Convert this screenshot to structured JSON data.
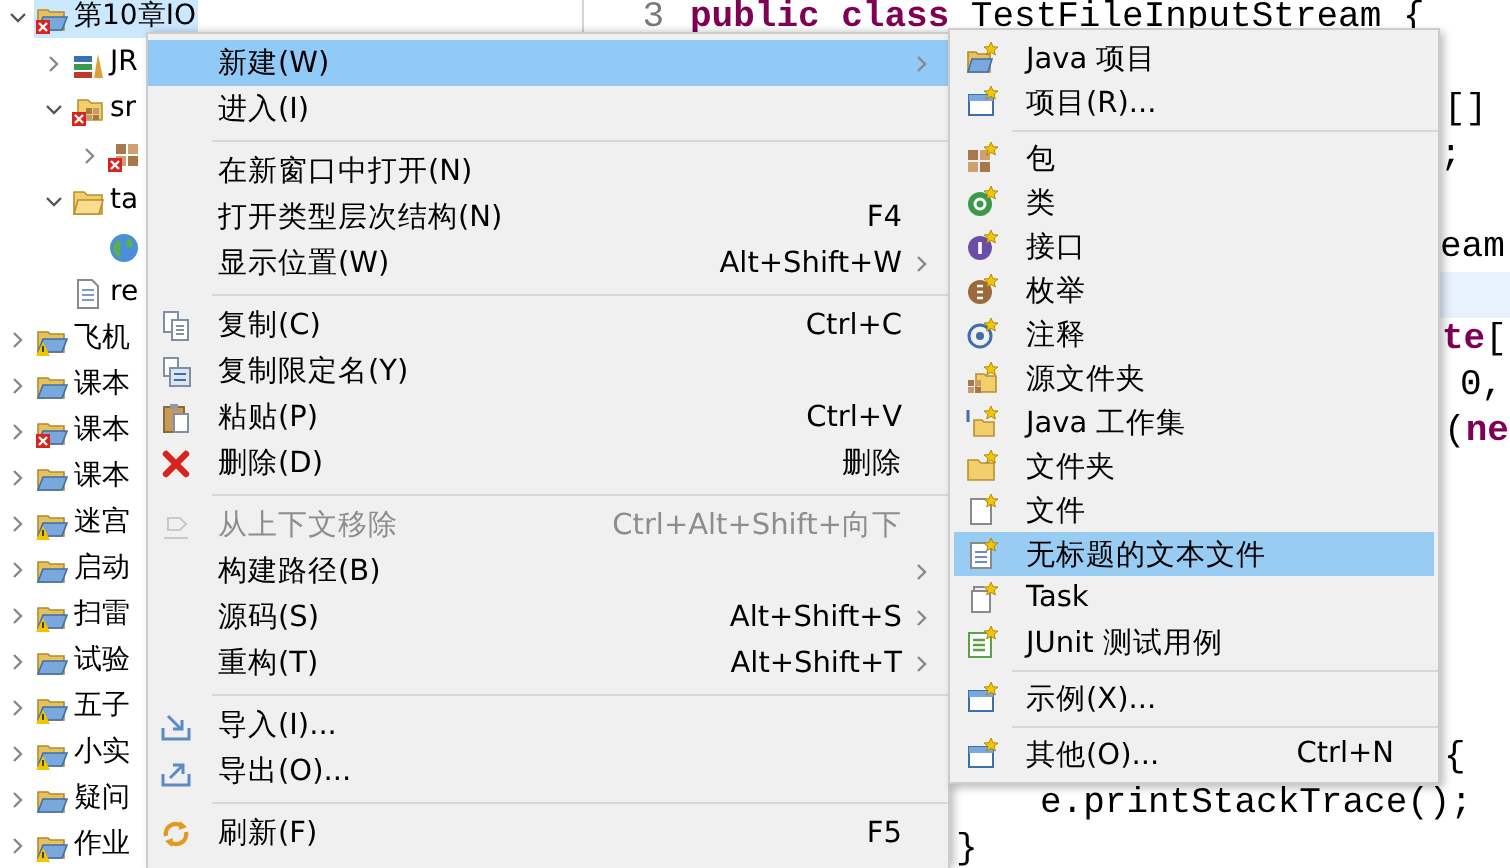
{
  "project_tree": [
    {
      "label": "第10章IO",
      "kind": "project",
      "error": true,
      "warning": false,
      "expanded": true,
      "selected": true,
      "children": [
        {
          "label": "JR",
          "kind": "library",
          "expanded": false,
          "selected": false
        },
        {
          "label": "sr",
          "kind": "source-folder",
          "error": true,
          "expanded": true,
          "selected": false,
          "children": [
            {
              "kind": "package",
              "error": true,
              "expanded": false,
              "selected": false
            }
          ]
        },
        {
          "label": "ta",
          "kind": "folder",
          "expanded": true,
          "selected": false,
          "children": [
            {
              "kind": "web-file",
              "selected": false
            }
          ]
        },
        {
          "label": "re",
          "kind": "file",
          "selected": false
        }
      ]
    },
    {
      "label": "飞机",
      "kind": "project",
      "error": false,
      "warning": true,
      "expanded": false,
      "selected": false
    },
    {
      "label": "课本",
      "kind": "project",
      "error": false,
      "warning": false,
      "expanded": false,
      "selected": false
    },
    {
      "label": "课本",
      "kind": "project",
      "error": true,
      "warning": false,
      "expanded": false,
      "selected": false
    },
    {
      "label": "课本",
      "kind": "project",
      "error": false,
      "warning": false,
      "expanded": false,
      "selected": false
    },
    {
      "label": "迷宫",
      "kind": "project",
      "error": false,
      "warning": true,
      "expanded": false,
      "selected": false
    },
    {
      "label": "启动",
      "kind": "project",
      "error": false,
      "warning": false,
      "expanded": false,
      "selected": false
    },
    {
      "label": "扫雷",
      "kind": "project",
      "error": false,
      "warning": true,
      "expanded": false,
      "selected": false
    },
    {
      "label": "试验",
      "kind": "project",
      "error": false,
      "warning": false,
      "expanded": false,
      "selected": false
    },
    {
      "label": "五子",
      "kind": "project",
      "error": false,
      "warning": true,
      "expanded": false,
      "selected": false
    },
    {
      "label": "小实",
      "kind": "project",
      "error": false,
      "warning": true,
      "expanded": false,
      "selected": false
    },
    {
      "label": "疑问",
      "kind": "project",
      "error": false,
      "warning": false,
      "expanded": false,
      "selected": false
    },
    {
      "label": "作业",
      "kind": "project",
      "error": false,
      "warning": true,
      "expanded": false,
      "selected": false
    }
  ],
  "editor": {
    "lines": [
      {
        "number": "3",
        "current": false,
        "tokens": [
          {
            "text": "public class",
            "kind": "keyword"
          },
          {
            "text": "TestFileInputStream {",
            "kind": "plain"
          }
        ]
      },
      {
        "current": false,
        "tokens": [
          {
            "text": "[]",
            "kind": "plain"
          }
        ]
      },
      {
        "current": false,
        "tokens": [
          {
            "text": ";",
            "kind": "plain"
          }
        ]
      },
      {
        "current": false,
        "tokens": [
          {
            "text": "eam",
            "kind": "plain"
          }
        ]
      },
      {
        "current": true
      },
      {
        "current": false,
        "tokens": [
          {
            "text": "te",
            "kind": "keyword"
          },
          {
            "text": "[",
            "kind": "plain"
          }
        ]
      },
      {
        "current": false,
        "tokens": [
          {
            "text": "0,",
            "kind": "plain"
          }
        ]
      },
      {
        "current": false,
        "tokens": [
          {
            "text": "(",
            "kind": "plain"
          },
          {
            "text": "ne",
            "kind": "keyword"
          }
        ]
      },
      {
        "current": false,
        "tokens": [
          {
            "text": "{",
            "kind": "plain"
          }
        ]
      },
      {
        "current": false,
        "tokens": [
          {
            "text": "e.printStackTrace();",
            "kind": "plain"
          }
        ]
      },
      {
        "current": false,
        "tokens": [
          {
            "text": "}",
            "kind": "plain"
          }
        ]
      }
    ]
  },
  "context_menu": {
    "items": [
      {
        "kind": "item",
        "label": "新建(W)",
        "submenu": true,
        "disabled": false,
        "selected": true
      },
      {
        "kind": "item",
        "label": "进入(I)",
        "submenu": false,
        "disabled": false,
        "selected": false
      },
      {
        "kind": "separator"
      },
      {
        "kind": "item",
        "label": "在新窗口中打开(N)",
        "submenu": false,
        "disabled": false,
        "selected": false
      },
      {
        "kind": "item",
        "label": "打开类型层次结构(N)",
        "shortcut": "F4",
        "submenu": false,
        "disabled": false,
        "selected": false
      },
      {
        "kind": "item",
        "label": "显示位置(W)",
        "shortcut": "Alt+Shift+W",
        "submenu": true,
        "disabled": false,
        "selected": false
      },
      {
        "kind": "separator"
      },
      {
        "kind": "item",
        "label": "复制(C)",
        "shortcut": "Ctrl+C",
        "submenu": false,
        "disabled": false,
        "selected": false
      },
      {
        "kind": "item",
        "label": "复制限定名(Y)",
        "submenu": false,
        "disabled": false,
        "selected": false
      },
      {
        "kind": "item",
        "label": "粘贴(P)",
        "shortcut": "Ctrl+V",
        "submenu": false,
        "disabled": false,
        "selected": false
      },
      {
        "kind": "item",
        "label": "删除(D)",
        "shortcut": "删除",
        "submenu": false,
        "disabled": false,
        "selected": false
      },
      {
        "kind": "separator"
      },
      {
        "kind": "item",
        "label": "从上下文移除",
        "shortcut": "Ctrl+Alt+Shift+向下",
        "submenu": false,
        "disabled": true,
        "selected": false
      },
      {
        "kind": "item",
        "label": "构建路径(B)",
        "submenu": true,
        "disabled": false,
        "selected": false
      },
      {
        "kind": "item",
        "label": "源码(S)",
        "shortcut": "Alt+Shift+S",
        "submenu": true,
        "disabled": false,
        "selected": false
      },
      {
        "kind": "item",
        "label": "重构(T)",
        "shortcut": "Alt+Shift+T",
        "submenu": true,
        "disabled": false,
        "selected": false
      },
      {
        "kind": "separator"
      },
      {
        "kind": "item",
        "label": "导入(I)...",
        "submenu": false,
        "disabled": false,
        "selected": false
      },
      {
        "kind": "item",
        "label": "导出(O)...",
        "submenu": false,
        "disabled": false,
        "selected": false
      },
      {
        "kind": "separator"
      },
      {
        "kind": "item",
        "label": "刷新(F)",
        "shortcut": "F5",
        "submenu": false,
        "disabled": false,
        "selected": false
      }
    ]
  },
  "new_submenu": {
    "items": [
      {
        "kind": "item",
        "label": "Java 项目",
        "selected": false
      },
      {
        "kind": "item",
        "label": "项目(R)...",
        "selected": false
      },
      {
        "kind": "separator"
      },
      {
        "kind": "item",
        "label": "包",
        "selected": false
      },
      {
        "kind": "item",
        "label": "类",
        "selected": false
      },
      {
        "kind": "item",
        "label": "接口",
        "selected": false
      },
      {
        "kind": "item",
        "label": "枚举",
        "selected": false
      },
      {
        "kind": "item",
        "label": "注释",
        "selected": false
      },
      {
        "kind": "item",
        "label": "源文件夹",
        "selected": false
      },
      {
        "kind": "item",
        "label": "Java 工作集",
        "selected": false
      },
      {
        "kind": "item",
        "label": "文件夹",
        "selected": false
      },
      {
        "kind": "item",
        "label": "文件",
        "selected": false
      },
      {
        "kind": "item",
        "label": "无标题的文本文件",
        "selected": true
      },
      {
        "kind": "item",
        "label": "Task",
        "selected": false
      },
      {
        "kind": "item",
        "label": "JUnit 测试用例",
        "selected": false
      },
      {
        "kind": "separator"
      },
      {
        "kind": "item",
        "label": "示例(X)...",
        "selected": false
      },
      {
        "kind": "separator"
      },
      {
        "kind": "item",
        "label": "其他(O)...",
        "shortcut": "Ctrl+N",
        "selected": false
      }
    ]
  }
}
